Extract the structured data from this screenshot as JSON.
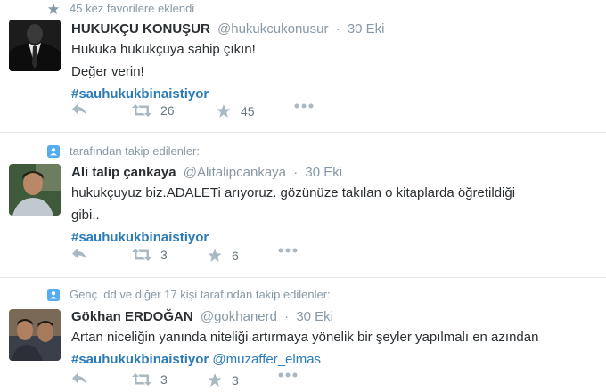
{
  "tweets": [
    {
      "context": "45 kez favorilere eklendi",
      "context_icon": "star-icon",
      "name": "HUKUKÇU KONUŞUR",
      "handle": "@hukukcukonusur",
      "time": "30 Eki",
      "lines": [
        "Hukuka hukukçuya sahip çıkın!",
        "Değer verin!"
      ],
      "hashtag": "#sauhukukbinaistiyor",
      "retweets": "26",
      "favorites": "45"
    },
    {
      "context": "tarafından takip edilenler:",
      "context_icon": "person-icon",
      "name": "Ali talip çankaya",
      "handle": "@Alitalipcankaya",
      "time": "30 Eki",
      "lines": [
        "hukukçuyuz biz.ADALETi arıyoruz. gözünüze takılan o kitaplarda öğretildiği",
        "gibi.."
      ],
      "hashtag": "#sauhukukbinaistiyor",
      "retweets": "3",
      "favorites": "6"
    },
    {
      "context": "Genç :dd ve diğer 17 kişi tarafından takip edilenler:",
      "context_icon": "person-icon",
      "name": "Gökhan ERDOĞAN",
      "handle": "@gokhanerd",
      "time": "30 Eki",
      "lines": [
        "Artan niceliğin yanında niteliği artırmaya yönelik bir şeyler yapılmalı en azından"
      ],
      "hashtag": "#sauhukukbinaistiyor",
      "mention": "@muzaffer_elmas",
      "retweets": "3",
      "favorites": "3"
    }
  ],
  "dot": "·",
  "colors": {
    "link": "#2b7bb9",
    "muted": "#8899a6",
    "text": "#292f33",
    "divider": "#e1e8ed"
  }
}
